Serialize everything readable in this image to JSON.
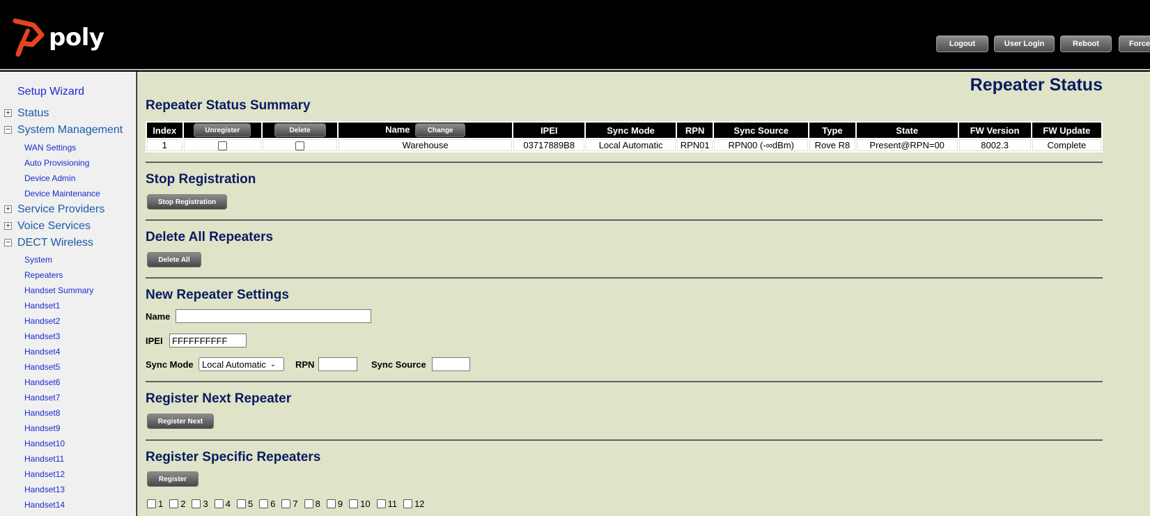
{
  "brand": {
    "name": "poly",
    "accent": "#e4451e"
  },
  "header": {
    "buttons": [
      "Logout",
      "User Login",
      "Reboot",
      "Force"
    ]
  },
  "sidebar": {
    "setup_wizard": "Setup Wizard",
    "status": "Status",
    "system_management": "System Management",
    "system_management_items": [
      "WAN Settings",
      "Auto Provisioning",
      "Device Admin",
      "Device Maintenance"
    ],
    "service_providers": "Service Providers",
    "voice_services": "Voice Services",
    "dect_wireless": "DECT Wireless",
    "dect_items": [
      "System",
      "Repeaters",
      "Handset Summary",
      "Handset1",
      "Handset2",
      "Handset3",
      "Handset4",
      "Handset5",
      "Handset6",
      "Handset7",
      "Handset8",
      "Handset9",
      "Handset10",
      "Handset11",
      "Handset12",
      "Handset13",
      "Handset14"
    ],
    "expand_symbol": "+",
    "collapse_symbol": "−"
  },
  "main": {
    "page_title": "Repeater Status",
    "summary": {
      "title": "Repeater Status Summary",
      "columns": [
        "Index",
        "Unregister",
        "Delete",
        "Name",
        "IPEI",
        "Sync Mode",
        "RPN",
        "Sync Source",
        "Type",
        "State",
        "FW Version",
        "FW Update"
      ],
      "change_label": "Change",
      "row": {
        "index": "1",
        "name": "Warehouse",
        "ipei": "03717889B8",
        "sync_mode": "Local Automatic",
        "rpn": "RPN01",
        "sync_source": "RPN00 (-∞dBm)",
        "type": "Rove R8",
        "state": "Present@RPN=00",
        "fw_version": "8002.3",
        "fw_update": "Complete"
      }
    },
    "stop_registration": {
      "title": "Stop Registration",
      "button": "Stop Registration"
    },
    "delete_all": {
      "title": "Delete All Repeaters",
      "button": "Delete All"
    },
    "new_repeater": {
      "title": "New Repeater Settings",
      "name_label": "Name",
      "name_value": "",
      "ipei_label": "IPEI",
      "ipei_value": "FFFFFFFFFF",
      "sync_mode_label": "Sync Mode",
      "sync_mode_value": "Local Automatic",
      "rpn_label": "RPN",
      "rpn_value": "",
      "sync_source_label": "Sync Source",
      "sync_source_value": ""
    },
    "register_next": {
      "title": "Register Next Repeater",
      "button": "Register Next"
    },
    "register_specific": {
      "title": "Register Specific Repeaters",
      "button": "Register",
      "options": [
        "1",
        "2",
        "3",
        "4",
        "5",
        "6",
        "7",
        "8",
        "9",
        "10",
        "11",
        "12"
      ]
    }
  }
}
